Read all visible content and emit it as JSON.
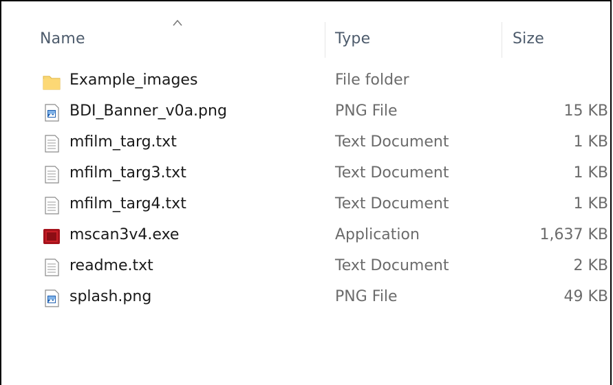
{
  "columns": {
    "name": "Name",
    "type": "Type",
    "size": "Size"
  },
  "files": [
    {
      "name": "Example_images",
      "type": "File folder",
      "size": "",
      "icon": "folder-icon"
    },
    {
      "name": "BDI_Banner_v0a.png",
      "type": "PNG File",
      "size": "15 KB",
      "icon": "png-file-icon"
    },
    {
      "name": "mfilm_targ.txt",
      "type": "Text Document",
      "size": "1 KB",
      "icon": "text-file-icon"
    },
    {
      "name": "mfilm_targ3.txt",
      "type": "Text Document",
      "size": "1 KB",
      "icon": "text-file-icon"
    },
    {
      "name": "mfilm_targ4.txt",
      "type": "Text Document",
      "size": "1 KB",
      "icon": "text-file-icon"
    },
    {
      "name": "mscan3v4.exe",
      "type": "Application",
      "size": "1,637 KB",
      "icon": "application-icon"
    },
    {
      "name": "readme.txt",
      "type": "Text Document",
      "size": "2 KB",
      "icon": "text-file-icon"
    },
    {
      "name": "splash.png",
      "type": "PNG File",
      "size": "49 KB",
      "icon": "png-file-icon"
    }
  ],
  "colors": {
    "folder": "#f8d775",
    "application": "#a5121b",
    "png_accent": "#1f5fb0"
  }
}
